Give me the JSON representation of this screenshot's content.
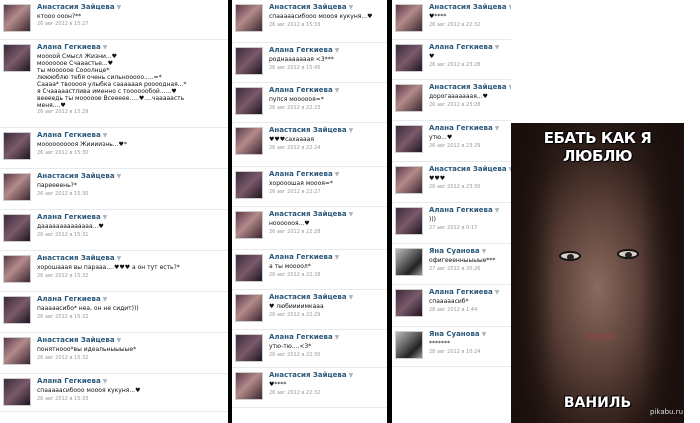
{
  "columns": [
    {
      "posts": [
        {
          "author": "Анастасия Зайцева",
          "msg": "ктооо ооон?**",
          "date": "26 авг 2012 в 15:27",
          "avatar": "a"
        },
        {
          "author": "Алана Гегкиева",
          "msg": "моооой Смысл Жизни...♥\nмоооооое Счааастье...♥\nты мооооое Сооолнце*\nлюююблю тебя очень сильнооооо.....=*\nСаааа* твооооя улыбка саааааая роооодная...*\nя Счааааастлива именно с тооооообой......♥\nвеееедь ты мооооое Всеееее.....♥....чааааасть меня....♥",
          "date": "26 авг 2012 в 15:29",
          "avatar": "b"
        },
        {
          "author": "Алана Гегкиева",
          "msg": "моооооооооя Жиииизнь...♥*",
          "date": "26 авг 2012 в 15:30",
          "avatar": "b"
        },
        {
          "author": "Анастасия Зайцева",
          "msg": "пареееень?*",
          "date": "26 авг 2012 в 15:30",
          "avatar": "a"
        },
        {
          "author": "Алана Гегкиева",
          "msg": "даааааааааааааа...♥",
          "date": "26 авг 2012 в 15:31",
          "avatar": "b"
        },
        {
          "author": "Анастасия Зайцева",
          "msg": "хорошааая вы парааа....♥♥♥ а он тут есть?*",
          "date": "26 авг 2012 в 15:32",
          "avatar": "a"
        },
        {
          "author": "Алана Гегкиева",
          "msg": "пааааасибо* неа, он не сидит)))",
          "date": "26 авг 2012 в 15:32",
          "avatar": "b"
        },
        {
          "author": "Анастасия Зайцева",
          "msg": "понятнооо*вы идеальныыыые*",
          "date": "26 авг 2012 в 15:32",
          "avatar": "a"
        },
        {
          "author": "Алана Гегкиева",
          "msg": "спааааасибооо моооя кукуня...♥",
          "date": "26 авг 2012 в 15:33",
          "avatar": "b"
        }
      ]
    },
    {
      "posts": [
        {
          "author": "Анастасия Зайцева",
          "msg": "спааааасибооо моооя кукуня...♥",
          "date": "26 авг 2012 в 15:33",
          "avatar": "a"
        },
        {
          "author": "Алана Гегкиева",
          "msg": "роднааааааая <3***",
          "date": "26 авг 2012 в 15:45",
          "avatar": "b"
        },
        {
          "author": "Алана Гегкиева",
          "msg": "пупся моооооя=*",
          "date": "26 авг 2012 в 22:23",
          "avatar": "b"
        },
        {
          "author": "Анастасия Зайцева",
          "msg": "♥♥♥сахаааая",
          "date": "26 авг 2012 в 22:24",
          "avatar": "a"
        },
        {
          "author": "Алана Гегкиева",
          "msg": "хорооошая моооя=*",
          "date": "26 авг 2012 в 22:27",
          "avatar": "b"
        },
        {
          "author": "Анастасия Зайцева",
          "msg": "нооооооя...♥",
          "date": "26 авг 2012 в 22:28",
          "avatar": "a"
        },
        {
          "author": "Алана Гегкиева",
          "msg": "а ты моооол*",
          "date": "26 авг 2012 в 22:28",
          "avatar": "b"
        },
        {
          "author": "Анастасия Зайцева",
          "msg": "♥ любиииимкааа",
          "date": "26 авг 2012 в 22:29",
          "avatar": "a"
        },
        {
          "author": "Алана Гегкиева",
          "msg": "утю-тю....<3*",
          "date": "26 авг 2012 в 22:30",
          "avatar": "b"
        },
        {
          "author": "Анастасия Зайцева",
          "msg": "♥****",
          "date": "26 авг 2012 в 22:32",
          "avatar": "a"
        }
      ]
    },
    {
      "posts": [
        {
          "author": "Анастасия Зайцева",
          "msg": "♥****",
          "date": "26 авг 2012 в 22:32",
          "avatar": "a"
        },
        {
          "author": "Алана Гегкиева",
          "msg": "♥",
          "date": "26 авг 2012 в 23:28",
          "avatar": "b"
        },
        {
          "author": "Анастасия Зайцева",
          "msg": "дорогааааааая...♥",
          "date": "26 авг 2012 в 23:28",
          "avatar": "a"
        },
        {
          "author": "Алана Гегкиева",
          "msg": "утю...♥",
          "date": "26 авг 2012 в 23:29",
          "avatar": "b"
        },
        {
          "author": "Анастасия Зайцева",
          "msg": "♥♥♥",
          "date": "26 авг 2012 в 23:30",
          "avatar": "a"
        },
        {
          "author": "Алана Гегкиева",
          "msg": ")))",
          "date": "27 авг 2012 в 0:17",
          "avatar": "b"
        },
        {
          "author": "Яна Суанова",
          "msg": "офигееенныыыые***",
          "date": "27 авг 2012 в 20:26",
          "avatar": "c"
        },
        {
          "author": "Алана Гегкиева",
          "msg": "спааааасиб*",
          "date": "28 авг 2012 в 1:44",
          "avatar": "b"
        },
        {
          "author": "Яна Суанова",
          "msg": "*******",
          "date": "28 авг 2012 в 10:24",
          "avatar": "c"
        }
      ]
    }
  ],
  "meme": {
    "top": "ЕБАТЬ КАК Я ЛЮБЛЮ",
    "bottom": "ВАНИЛЬ"
  },
  "watermark": "pikabu.ru"
}
